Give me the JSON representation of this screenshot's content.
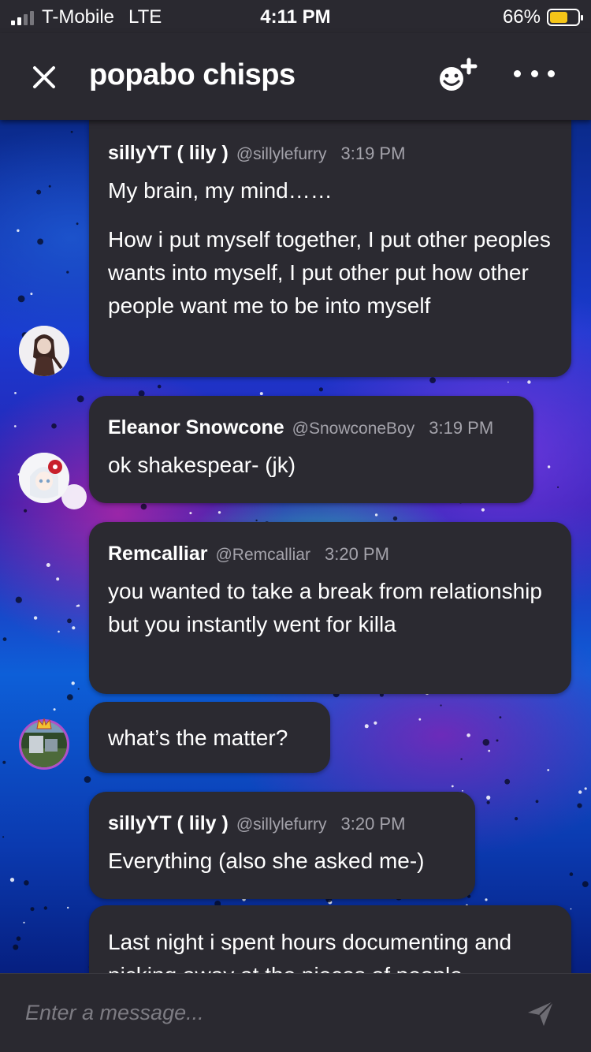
{
  "status_bar": {
    "carrier": "T-Mobile",
    "network": "LTE",
    "time": "4:11 PM",
    "battery_percent_label": "66%",
    "battery_level": 0.66,
    "battery_color": "#f5c518"
  },
  "header": {
    "title": "popabo chisps",
    "close_icon": "close-icon",
    "add_member_icon": "add-member-icon",
    "more_icon": "more-options-icon"
  },
  "messages": [
    {
      "author": "sillyYT ( lily )",
      "handle": "@sillylefurry",
      "time": "3:19 PM",
      "lines": [
        "My brain, my mind……",
        "How i put myself together, I put other peoples wants into myself, I put other put how other people want me to be into myself"
      ]
    },
    {
      "author": "Eleanor Snowcone",
      "handle": "@SnowconeBoy",
      "time": "3:19 PM",
      "lines": [
        "ok shakespear- (jk)"
      ]
    },
    {
      "author": "Remcalliar",
      "handle": "@Remcalliar",
      "time": "3:20 PM",
      "lines": [
        "you wanted to take a break from relationship but you instantly went for killa"
      ]
    },
    {
      "lines": [
        "what’s the matter?"
      ]
    },
    {
      "author": "sillyYT ( lily )",
      "handle": "@sillylefurry",
      "time": "3:20 PM",
      "lines": [
        "Everything (also she asked me-)"
      ]
    },
    {
      "lines": [
        "Last night i spent hours documenting and picking away at the pieces of people"
      ]
    }
  ],
  "composer": {
    "placeholder": "Enter a message...",
    "send_icon": "send-icon"
  }
}
